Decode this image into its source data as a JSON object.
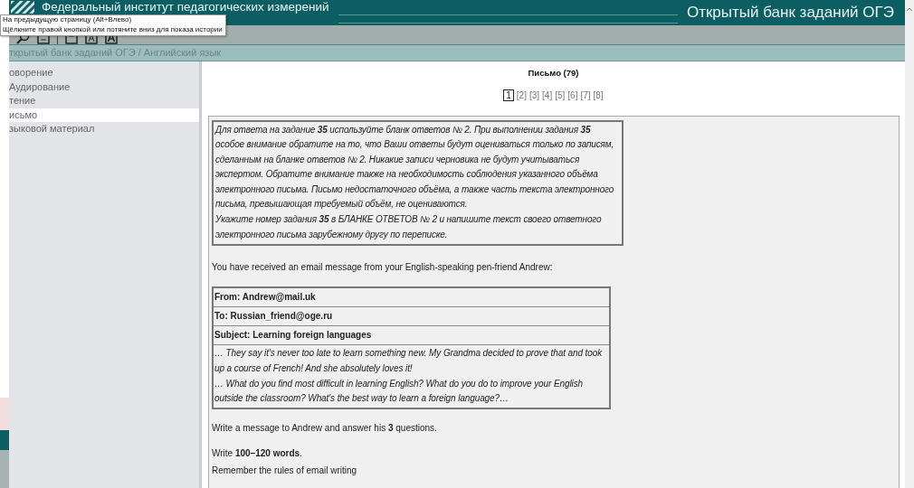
{
  "header": {
    "institute": "Федеральный институт педагогических измерений",
    "bank_title": "Открытый банк заданий ОГЭ"
  },
  "tooltip": {
    "lines": [
      "На предыдущую страницу (Alt+Влево)",
      "Щёлкните правой кнопкой или потяните вниз для показа истории"
    ]
  },
  "breadcrumb": "ткрытый банк заданий ОГЭ / Английский язык",
  "sidebar": {
    "items": [
      {
        "label": "оворение",
        "selected": false
      },
      {
        "label": "Аудирование",
        "selected": false
      },
      {
        "label": "тение",
        "selected": false
      },
      {
        "label": "исьмо",
        "selected": true
      },
      {
        "label": "зыковой материал",
        "selected": false
      }
    ]
  },
  "content": {
    "title": "Письмо (79)",
    "pages": [
      {
        "label": "1",
        "selected": true
      },
      {
        "label": "[2]",
        "selected": false
      },
      {
        "label": "[3]",
        "selected": false
      },
      {
        "label": "[4]",
        "selected": false
      },
      {
        "label": "[5]",
        "selected": false
      },
      {
        "label": "[6]",
        "selected": false
      },
      {
        "label": "[7]",
        "selected": false
      },
      {
        "label": "[8]",
        "selected": false
      }
    ],
    "instructions": [
      "Для ответа на задание **35** используйте бланк ответов № 2. При выполнении задания **35** особое внимание обратите на то, что Ваши ответы будут оцениваться только по записям, сделанным на бланке ответов № 2. Никакие записи черновика не будут учитываться экспертом. Обратите внимание также на необходимость соблюдения указанного объёма электронного письма. Письмо недостаточного объёма, а также часть текста электронного письма, превышающая требуемый объём, не оцениваются.",
      "Укажите номер задания **35** в БЛАНКЕ ОТВЕТОВ № 2 и напишите текст своего ответного электронного письма зарубежному другу по переписке."
    ],
    "intro": "You have received an email message from your English-speaking pen-friend Andrew:",
    "email": {
      "headers": [
        "From: Andrew@mail.uk",
        "To: Russian_friend@oge.ru",
        "Subject: Learning foreign languages"
      ],
      "body": [
        "… They say it's never too late to learn something new. My Grandma decided to prove that and took up a course of French! And she absolutely loves it!",
        "… What do you find most difficult in learning English? What do you do to improve your English outside the classroom? What's the best way to learn a foreign language?…"
      ]
    },
    "tasks": [
      "Write a message to Andrew and answer his **3** questions.",
      "Write **100–120 words**.",
      "Remember the rules of email writing"
    ]
  }
}
